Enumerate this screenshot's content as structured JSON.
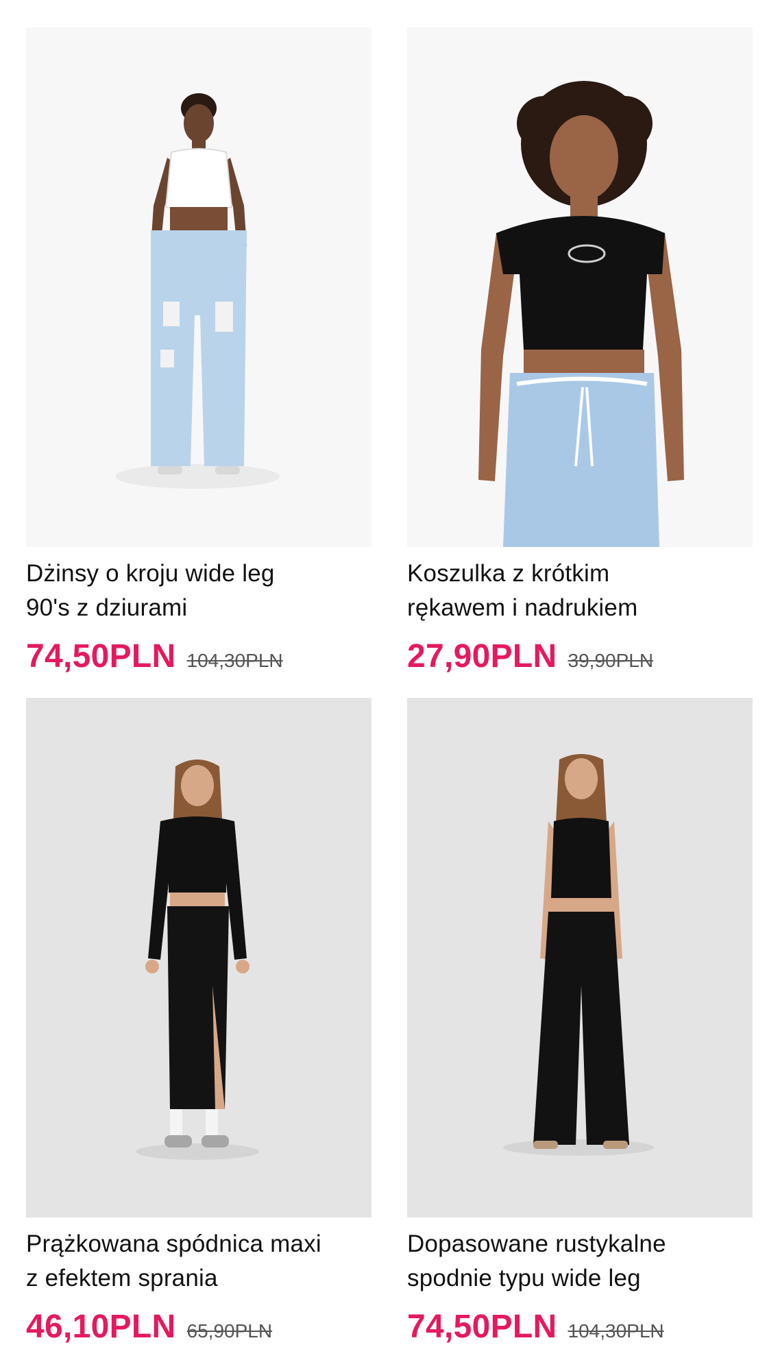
{
  "colors": {
    "price": "#e5195f",
    "old_price": "#555555",
    "title": "#111111",
    "photo_bg_light": "#f7f7f7",
    "photo_bg_gray": "#e4e4e4"
  },
  "products": [
    {
      "title_line1": "Dżinsy o kroju wide leg",
      "title_line2": "90's z dziurami",
      "price": "74,50PLN",
      "old_price": "104,30PLN",
      "image": "product-photo-woman-white-top-ripped-jeans"
    },
    {
      "title_line1": "Koszulka z krótkim",
      "title_line2": "rękawem i nadrukiem",
      "price": "27,90PLN",
      "old_price": "39,90PLN",
      "image": "product-photo-woman-black-tee-print"
    },
    {
      "title_line1": "Prążkowana spódnica maxi",
      "title_line2": "z efektem sprania",
      "price": "46,10PLN",
      "old_price": "65,90PLN",
      "image": "product-photo-woman-black-maxi-skirt"
    },
    {
      "title_line1": "Dopasowane rustykalne",
      "title_line2": "spodnie typu wide leg",
      "price": "74,50PLN",
      "old_price": "104,30PLN",
      "image": "product-photo-woman-black-wide-trousers"
    }
  ]
}
